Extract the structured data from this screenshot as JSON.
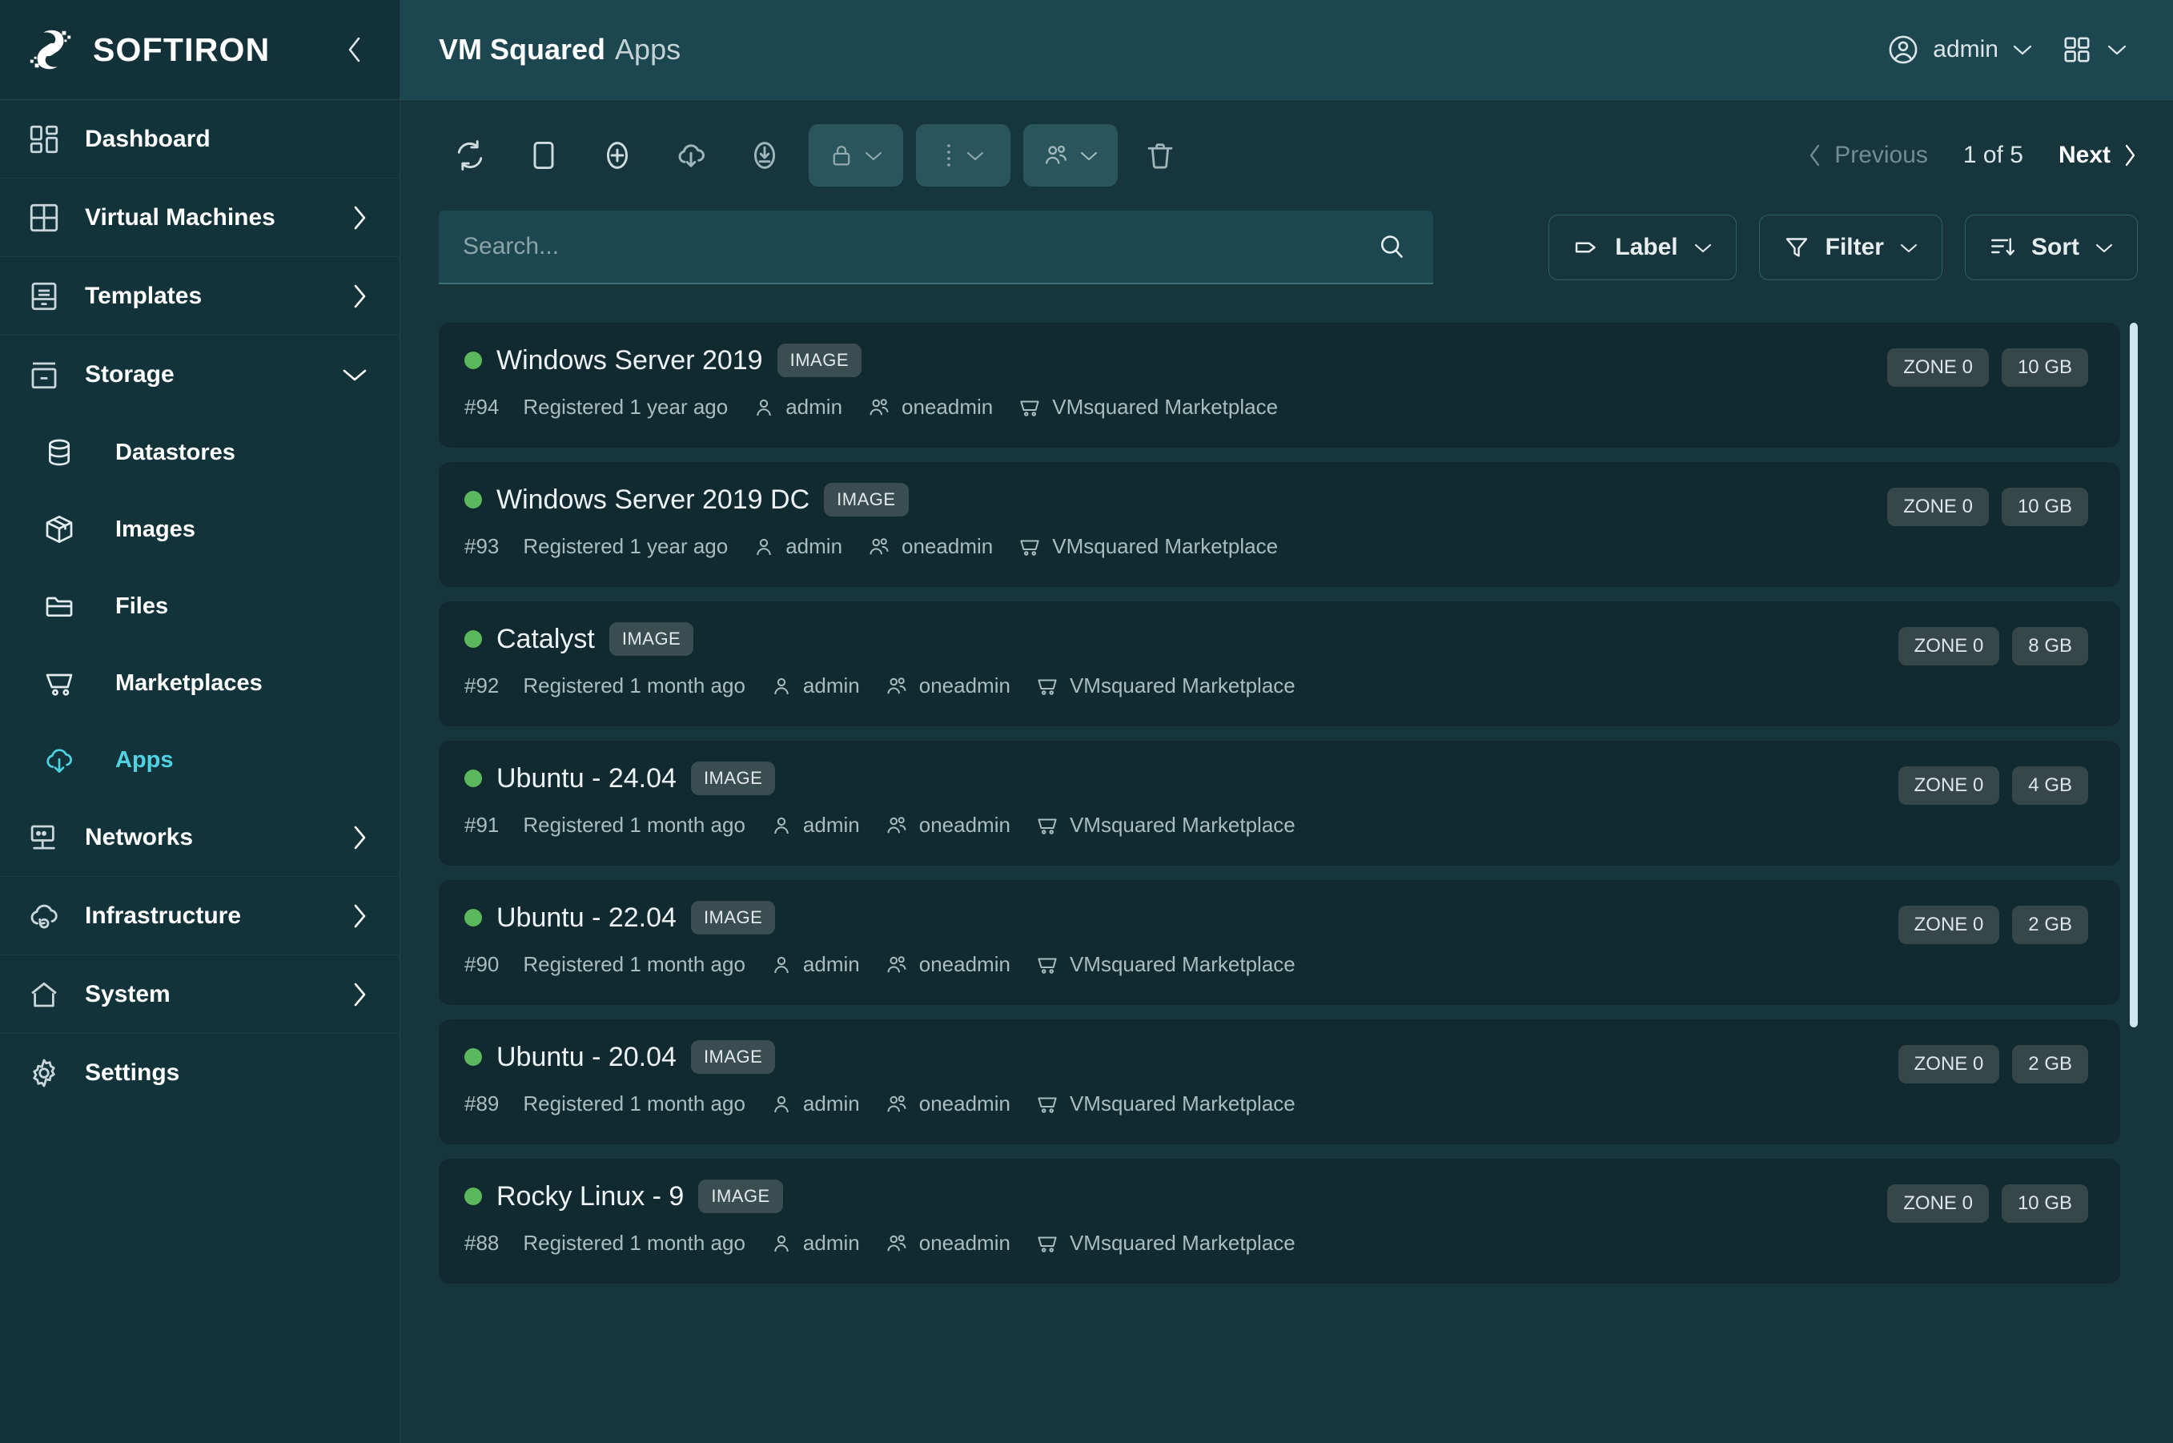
{
  "brand": {
    "name": "SOFTIRON",
    "logo_icon": "softiron-logo",
    "collapse_icon": "chevron-left-icon"
  },
  "sidebar": {
    "items": [
      {
        "label": "Dashboard",
        "icon": "dashboard-icon",
        "arrow": "",
        "level": "top"
      },
      {
        "label": "Virtual Machines",
        "icon": "grid-squares-icon",
        "arrow": "chevron-right-icon",
        "level": "top"
      },
      {
        "label": "Templates",
        "icon": "drawer-icon",
        "arrow": "chevron-right-icon",
        "level": "top"
      },
      {
        "label": "Storage",
        "icon": "storage-box-icon",
        "arrow": "chevron-down-icon",
        "level": "top"
      },
      {
        "label": "Datastores",
        "icon": "database-icon",
        "arrow": "",
        "level": "sub"
      },
      {
        "label": "Images",
        "icon": "package-icon",
        "arrow": "",
        "level": "sub"
      },
      {
        "label": "Files",
        "icon": "folder-icon",
        "arrow": "",
        "level": "sub"
      },
      {
        "label": "Marketplaces",
        "icon": "shopping-cart-icon",
        "arrow": "",
        "level": "sub"
      },
      {
        "label": "Apps",
        "icon": "cloud-download-icon",
        "arrow": "",
        "level": "sub",
        "active": true
      },
      {
        "label": "Networks",
        "icon": "network-monitor-icon",
        "arrow": "chevron-right-icon",
        "level": "top"
      },
      {
        "label": "Infrastructure",
        "icon": "cloud-sync-icon",
        "arrow": "chevron-right-icon",
        "level": "top"
      },
      {
        "label": "System",
        "icon": "home-icon",
        "arrow": "chevron-right-icon",
        "level": "top"
      },
      {
        "label": "Settings",
        "icon": "gear-icon",
        "arrow": "",
        "level": "top"
      }
    ],
    "active_accent": "#4fd2e2"
  },
  "header": {
    "title": "VM Squared",
    "subtitle": "Apps",
    "user": {
      "name": "admin",
      "icon": "user-circle-icon",
      "caret": "chevron-down-icon"
    },
    "apps_menu": {
      "icon": "grid-apps-icon",
      "caret": "chevron-down-icon"
    }
  },
  "toolbar": {
    "icons": [
      {
        "name": "refresh-icon"
      },
      {
        "name": "select-all-icon"
      },
      {
        "name": "add-icon"
      },
      {
        "name": "cloud-download-icon"
      },
      {
        "name": "download-icon"
      }
    ],
    "dropdowns": [
      {
        "name": "lock-dropdown",
        "icon": "lock-icon"
      },
      {
        "name": "more-dropdown",
        "icon": "kebab-menu-icon"
      },
      {
        "name": "ownership-dropdown",
        "icon": "users-icon"
      }
    ],
    "delete": {
      "name": "delete-icon"
    },
    "pagination": {
      "previous": "Previous",
      "count": "1 of 5",
      "next": "Next"
    }
  },
  "search": {
    "placeholder": "Search...",
    "value": "",
    "icon": "search-icon"
  },
  "controls": [
    {
      "label": "Label",
      "icon": "tag-icon",
      "caret": "chevron-down-icon"
    },
    {
      "label": "Filter",
      "icon": "funnel-icon",
      "caret": "chevron-down-icon"
    },
    {
      "label": "Sort",
      "icon": "sort-icon",
      "caret": "chevron-down-icon"
    }
  ],
  "list": {
    "status_color": "#5cb85c",
    "meta_icons": {
      "owner": "user-icon",
      "group": "users-icon",
      "source": "shopping-cart-icon"
    },
    "rows": [
      {
        "name": "Windows Server 2019",
        "type": "IMAGE",
        "id": "#94",
        "registered": "Registered 1 year ago",
        "owner": "admin",
        "group": "oneadmin",
        "source": "VMsquared Marketplace",
        "zone": "ZONE 0",
        "size": "10 GB"
      },
      {
        "name": "Windows Server 2019 DC",
        "type": "IMAGE",
        "id": "#93",
        "registered": "Registered 1 year ago",
        "owner": "admin",
        "group": "oneadmin",
        "source": "VMsquared Marketplace",
        "zone": "ZONE 0",
        "size": "10 GB"
      },
      {
        "name": "Catalyst",
        "type": "IMAGE",
        "id": "#92",
        "registered": "Registered 1 month ago",
        "owner": "admin",
        "group": "oneadmin",
        "source": "VMsquared Marketplace",
        "zone": "ZONE 0",
        "size": "8 GB"
      },
      {
        "name": "Ubuntu - 24.04",
        "type": "IMAGE",
        "id": "#91",
        "registered": "Registered 1 month ago",
        "owner": "admin",
        "group": "oneadmin",
        "source": "VMsquared Marketplace",
        "zone": "ZONE 0",
        "size": "4 GB"
      },
      {
        "name": "Ubuntu - 22.04",
        "type": "IMAGE",
        "id": "#90",
        "registered": "Registered 1 month ago",
        "owner": "admin",
        "group": "oneadmin",
        "source": "VMsquared Marketplace",
        "zone": "ZONE 0",
        "size": "2 GB"
      },
      {
        "name": "Ubuntu - 20.04",
        "type": "IMAGE",
        "id": "#89",
        "registered": "Registered 1 month ago",
        "owner": "admin",
        "group": "oneadmin",
        "source": "VMsquared Marketplace",
        "zone": "ZONE 0",
        "size": "2 GB"
      },
      {
        "name": "Rocky Linux - 9",
        "type": "IMAGE",
        "id": "#88",
        "registered": "Registered 1 month ago",
        "owner": "admin",
        "group": "oneadmin",
        "source": "VMsquared Marketplace",
        "zone": "ZONE 0",
        "size": "10 GB"
      }
    ]
  }
}
